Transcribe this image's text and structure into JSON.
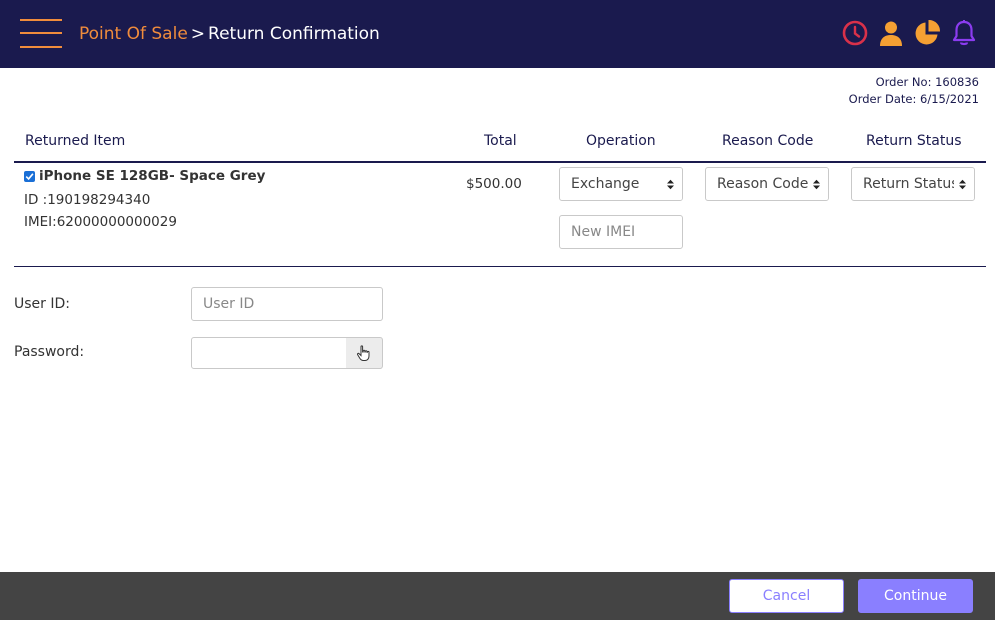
{
  "header": {
    "breadcrumb_root": "Point Of Sale",
    "breadcrumb_separator": ">",
    "breadcrumb_current": "Return Confirmation",
    "icons": [
      "history-clock-icon",
      "user-icon",
      "pie-chart-icon",
      "bell-icon"
    ]
  },
  "order": {
    "number_text": "Order No: 160836",
    "date_text": "Order Date: 6/15/2021"
  },
  "table": {
    "headers": {
      "item": "Returned Item",
      "total": "Total",
      "operation": "Operation",
      "reason": "Reason Code",
      "status": "Return Status"
    },
    "rows": [
      {
        "checked": true,
        "name": "iPhone SE 128GB- Space Grey",
        "id_text": "ID :190198294340",
        "imei_text": "IMEI:62000000000029",
        "total": "$500.00",
        "operation": "Exchange",
        "reason": "Reason Code",
        "status": "Return Status",
        "new_imei_placeholder": "New IMEI"
      }
    ]
  },
  "auth": {
    "user_id_label": "User ID:",
    "user_id_placeholder": "User ID",
    "password_label": "Password:",
    "password_value": ""
  },
  "footer": {
    "cancel_label": "Cancel",
    "continue_label": "Continue"
  },
  "colors": {
    "header_bg": "#1a1a4e",
    "accent_orange": "#f08c3c",
    "clock_red": "#d9314a",
    "bell_purple": "#8b3cf0",
    "button_purple": "#8a7fff",
    "footer_bg": "#444444"
  }
}
